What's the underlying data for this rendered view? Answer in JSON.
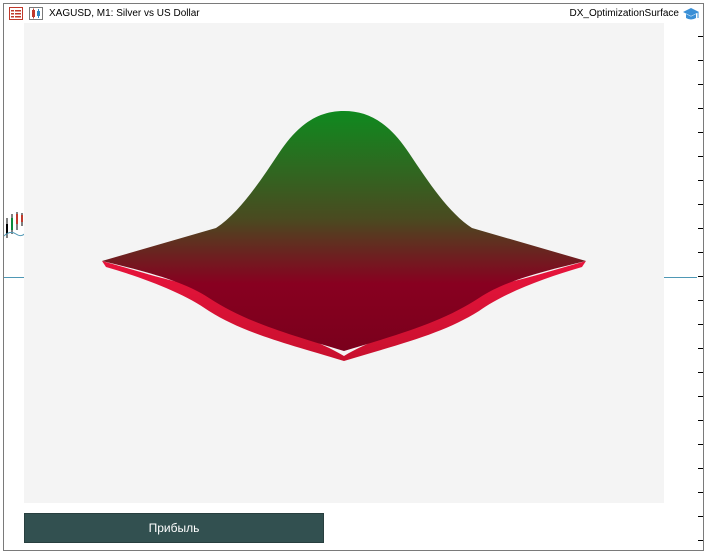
{
  "window": {
    "title": "XAGUSD, M1:  Silver vs US Dollar",
    "expert_name": "DX_OptimizationSurface"
  },
  "icons": {
    "menu": "chart-menu-icon",
    "chart": "chart-window-icon",
    "expert": "graduation-cap-icon"
  },
  "surface": {
    "type": "3d-surface",
    "peak_color": "#0f8a1f",
    "low_color": "#880020",
    "edge_color": "#e8143c",
    "background": "#f4f4f4"
  },
  "button": {
    "label": "Прибыль"
  },
  "colors": {
    "price_line": "#4f98b5",
    "button_bg": "#325050"
  }
}
